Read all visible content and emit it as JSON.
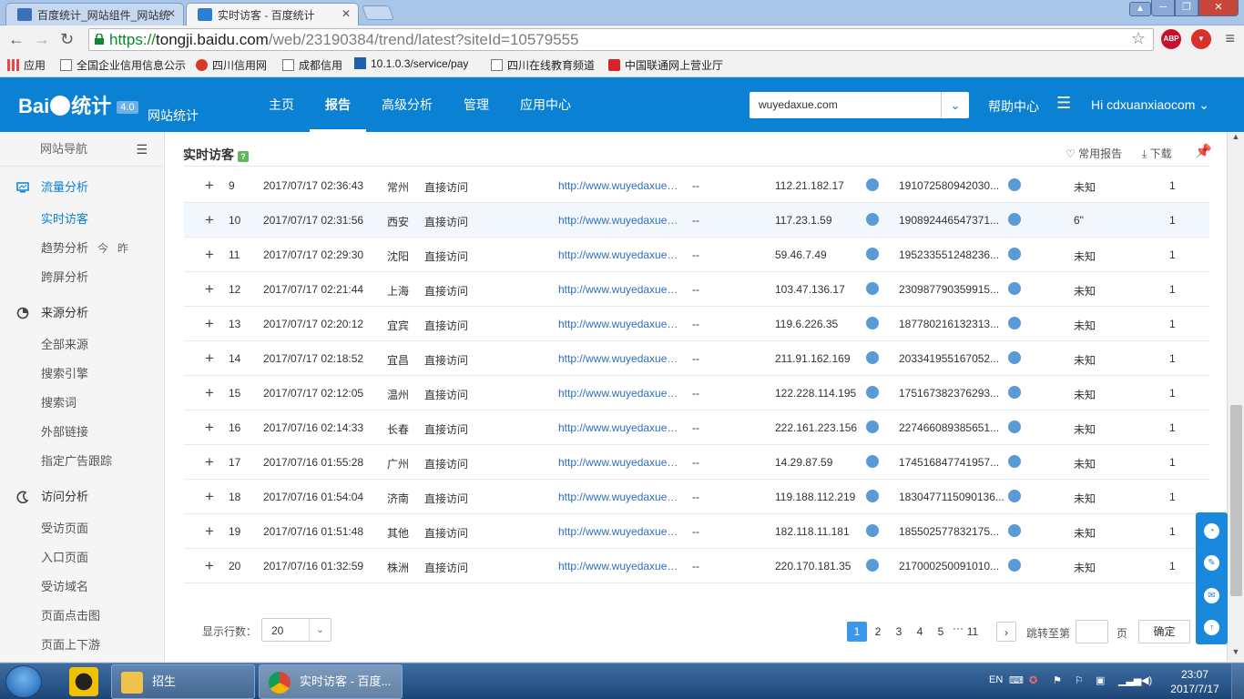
{
  "browser": {
    "tabs": [
      {
        "label": "百度统计_网站组件_网站统"
      },
      {
        "label": "实时访客 - 百度统计"
      }
    ],
    "user_icon": "user-icon",
    "url": {
      "proto": "https://",
      "host": "tongji.baidu.com",
      "path": "/web/23190384/trend/latest?siteId=10579555"
    },
    "ext1_label": "ABP",
    "bookmarks": [
      {
        "label": "应用"
      },
      {
        "label": "全国企业信用信息公示"
      },
      {
        "label": "四川信用网"
      },
      {
        "label": "成都信用"
      },
      {
        "label": "10.1.0.3/service/pay"
      },
      {
        "label": "四川在线教育频道"
      },
      {
        "label": "中国联通网上营业厅"
      }
    ]
  },
  "header": {
    "logo_text_a": "Bai",
    "logo_text_b": "统计",
    "logo_version": "4.0",
    "logo_sub": "网站统计",
    "nav": [
      {
        "label": "主页"
      },
      {
        "label": "报告"
      },
      {
        "label": "高级分析"
      },
      {
        "label": "管理"
      },
      {
        "label": "应用中心"
      }
    ],
    "site_select": "wuyedaxue.com",
    "help": "帮助中心",
    "user": "Hi  cdxuanxiaocom"
  },
  "sidebar": {
    "nav_title": "网站导航",
    "groups": [
      {
        "label": "流量分析",
        "items": [
          {
            "label": "实时访客"
          },
          {
            "label": "趋势分析",
            "tags": [
              "今",
              "昨"
            ]
          },
          {
            "label": "跨屏分析"
          }
        ]
      },
      {
        "label": "来源分析",
        "items": [
          {
            "label": "全部来源"
          },
          {
            "label": "搜索引擎"
          },
          {
            "label": "搜索词"
          },
          {
            "label": "外部链接"
          },
          {
            "label": "指定广告跟踪"
          }
        ]
      },
      {
        "label": "访问分析",
        "items": [
          {
            "label": "受访页面"
          },
          {
            "label": "入口页面"
          },
          {
            "label": "受访域名"
          },
          {
            "label": "页面点击图"
          },
          {
            "label": "页面上下游"
          }
        ]
      }
    ]
  },
  "content": {
    "title": "实时访客",
    "help_mark": "?",
    "actions": {
      "favorite": "常用报告",
      "download": "下载"
    },
    "rows": [
      {
        "idx": "9",
        "time": "2017/07/17 02:36:43",
        "city": "常州",
        "source": "直接访问",
        "url": "http://www.wuyedaxue.com/",
        "keyword": "--",
        "ip": "112.21.182.17",
        "visitor": "191072580942030...",
        "duration": "未知",
        "pages": "1"
      },
      {
        "idx": "10",
        "time": "2017/07/17 02:31:56",
        "city": "西安",
        "source": "直接访问",
        "url": "http://www.wuyedaxue.com/",
        "keyword": "--",
        "ip": "117.23.1.59",
        "visitor": "190892446547371...",
        "duration": "6\"",
        "pages": "1"
      },
      {
        "idx": "11",
        "time": "2017/07/17 02:29:30",
        "city": "沈阳",
        "source": "直接访问",
        "url": "http://www.wuyedaxue.com/",
        "keyword": "--",
        "ip": "59.46.7.49",
        "visitor": "195233551248236...",
        "duration": "未知",
        "pages": "1"
      },
      {
        "idx": "12",
        "time": "2017/07/17 02:21:44",
        "city": "上海",
        "source": "直接访问",
        "url": "http://www.wuyedaxue.com/",
        "keyword": "--",
        "ip": "103.47.136.17",
        "visitor": "230987790359915...",
        "duration": "未知",
        "pages": "1"
      },
      {
        "idx": "13",
        "time": "2017/07/17 02:20:12",
        "city": "宜宾",
        "source": "直接访问",
        "url": "http://www.wuyedaxue.com/",
        "keyword": "--",
        "ip": "119.6.226.35",
        "visitor": "187780216132313...",
        "duration": "未知",
        "pages": "1"
      },
      {
        "idx": "14",
        "time": "2017/07/17 02:18:52",
        "city": "宜昌",
        "source": "直接访问",
        "url": "http://www.wuyedaxue.com/",
        "keyword": "--",
        "ip": "211.91.162.169",
        "visitor": "203341955167052...",
        "duration": "未知",
        "pages": "1"
      },
      {
        "idx": "15",
        "time": "2017/07/17 02:12:05",
        "city": "温州",
        "source": "直接访问",
        "url": "http://www.wuyedaxue.com/",
        "keyword": "--",
        "ip": "122.228.114.195",
        "visitor": "175167382376293...",
        "duration": "未知",
        "pages": "1"
      },
      {
        "idx": "16",
        "time": "2017/07/16 02:14:33",
        "city": "长春",
        "source": "直接访问",
        "url": "http://www.wuyedaxue.com/",
        "keyword": "--",
        "ip": "222.161.223.156",
        "visitor": "227466089385651...",
        "duration": "未知",
        "pages": "1"
      },
      {
        "idx": "17",
        "time": "2017/07/16 01:55:28",
        "city": "广州",
        "source": "直接访问",
        "url": "http://www.wuyedaxue.com/",
        "keyword": "--",
        "ip": "14.29.87.59",
        "visitor": "174516847741957...",
        "duration": "未知",
        "pages": "1"
      },
      {
        "idx": "18",
        "time": "2017/07/16 01:54:04",
        "city": "济南",
        "source": "直接访问",
        "url": "http://www.wuyedaxue.com/",
        "keyword": "--",
        "ip": "119.188.112.219",
        "visitor": "1830477115090136...",
        "duration": "未知",
        "pages": "1"
      },
      {
        "idx": "19",
        "time": "2017/07/16 01:51:48",
        "city": "其他",
        "source": "直接访问",
        "url": "http://www.wuyedaxue.com/",
        "keyword": "--",
        "ip": "182.118.11.181",
        "visitor": "185502577832175...",
        "duration": "未知",
        "pages": "1"
      },
      {
        "idx": "20",
        "time": "2017/07/16 01:32:59",
        "city": "株洲",
        "source": "直接访问",
        "url": "http://www.wuyedaxue.com/",
        "keyword": "--",
        "ip": "220.170.181.35",
        "visitor": "217000250091010...",
        "duration": "未知",
        "pages": "1"
      }
    ],
    "pager": {
      "rows_label": "显示行数：",
      "rows_value": "20",
      "pages": [
        "1",
        "2",
        "3",
        "4",
        "5"
      ],
      "ellipsis": "···",
      "last": "11",
      "next": "›",
      "jump_label": "跳转至第",
      "page_unit": "页",
      "ok": "确定"
    }
  },
  "taskbar": {
    "apps": [
      {
        "label": "招生"
      },
      {
        "label": "实时访客 - 百度..."
      }
    ],
    "lang": "EN",
    "time": "23:07",
    "date": "2017/7/17"
  },
  "colors": {
    "brand": "#0b81d4",
    "link": "#2f6fbf",
    "active_page": "#3c99ea"
  }
}
